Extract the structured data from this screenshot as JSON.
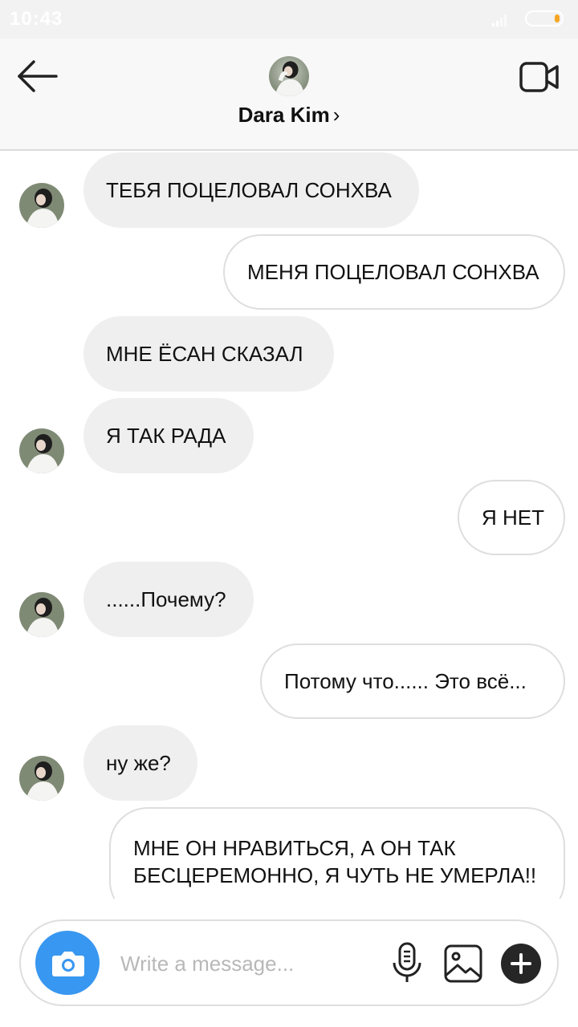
{
  "status_bar": {
    "time": "10:43",
    "battery_color": "#f5a623"
  },
  "header": {
    "contact_name": "Dara Kim",
    "chevron": "›",
    "back_icon": "arrow-left-icon",
    "video_icon": "video-call-icon"
  },
  "messages": [
    {
      "side": "in",
      "text": "ТЕБЯ ПОЦЕЛОВАЛ СОНХВА",
      "avatar": true
    },
    {
      "side": "out",
      "text": "МЕНЯ ПОЦЕЛОВАЛ СОНХВА"
    },
    {
      "side": "in",
      "text": "МНЕ ЁСАН СКАЗАЛ",
      "avatar": false
    },
    {
      "side": "in",
      "text": "Я ТАК РАДА",
      "avatar": true
    },
    {
      "side": "out",
      "text": "Я НЕТ"
    },
    {
      "side": "in",
      "text": "......Почему?",
      "avatar": true
    },
    {
      "side": "out",
      "text": "Потому что...... Это всё..."
    },
    {
      "side": "in",
      "text": "ну же?",
      "avatar": true
    },
    {
      "side": "out",
      "text": "МНЕ ОН НРАВИТЬСЯ, А ОН ТАК БЕСЦЕРЕМОННО, Я ЧУТЬ НЕ УМЕРЛА!!"
    }
  ],
  "composer": {
    "placeholder": "Write a message...",
    "camera_icon": "camera-icon",
    "mic_icon": "microphone-icon",
    "gallery_icon": "gallery-icon",
    "plus_icon": "plus-icon",
    "camera_color": "#3897f0"
  },
  "colors": {
    "incoming_bubble": "#efefef",
    "outgoing_border": "#dedede"
  }
}
